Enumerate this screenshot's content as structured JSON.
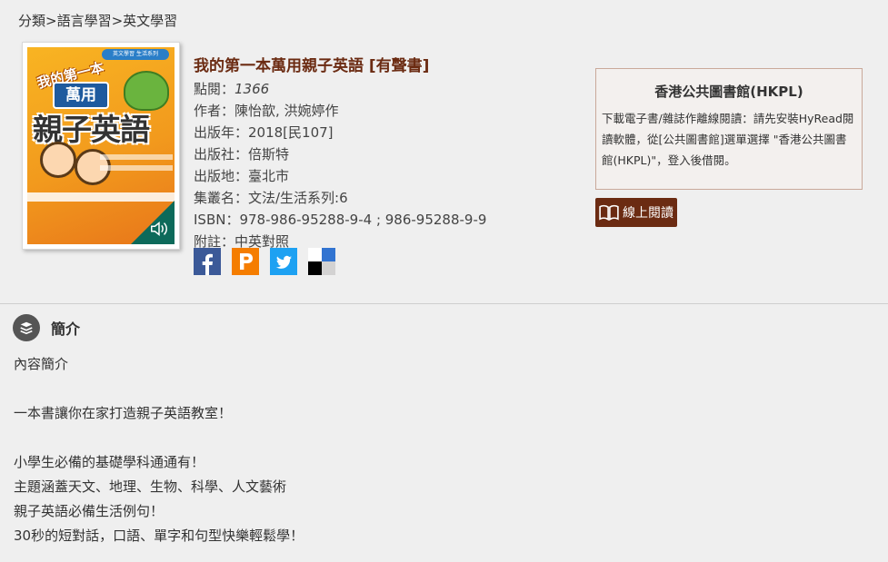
{
  "breadcrumb": "分類>語言學習>英文學習",
  "cover": {
    "badge": "英文學習 生活系列",
    "title_line1": "我的第一本",
    "title_line2": "萬用",
    "title_line3": "親子英語"
  },
  "book": {
    "title": "我的第一本萬用親子英語 [有聲書]",
    "views_label": "點閱：",
    "views": "1366",
    "author": "作者：陳怡歆, 洪婉婷作",
    "year": "出版年：2018[民107]",
    "publisher": "出版社：倍斯特",
    "place": "出版地：臺北市",
    "series": "集叢名：文法/生活系列:6",
    "isbn": "ISBN：978-986-95288-9-4 ; 986-95288-9-9",
    "note": "附註：中英對照"
  },
  "share": {
    "icons": [
      "facebook-icon",
      "plurk-icon",
      "twitter-icon",
      "delicious-icon"
    ],
    "colors": {
      "facebook": "#3b5998",
      "plurk": "#f57d00",
      "twitter": "#1da1f2",
      "delicious": "#3274d1"
    }
  },
  "library": {
    "name": "香港公共圖書館(HKPL)",
    "note": "下載電子書/雜誌作離線閱讀：請先安裝HyRead閱讀軟體，從[公共圖書館]選單選擇 \"香港公共圖書館(HKPL)\"，登入後借閱。"
  },
  "read_button": {
    "label": "線上閱讀",
    "color": "#6b2b12",
    "icon": "book-icon"
  },
  "intro": {
    "heading": "簡介",
    "icon": "books-icon",
    "lines": [
      "內容簡介",
      "",
      "一本書讓你在家打造親子英語教室！",
      "",
      "小學生必備的基礎學科通通有！",
      "主題涵蓋天文、地理、生物、科學、人文藝術",
      "親子英語必備生活例句！",
      "30秒的短對話，口語、單字和句型快樂輕鬆學！"
    ]
  }
}
